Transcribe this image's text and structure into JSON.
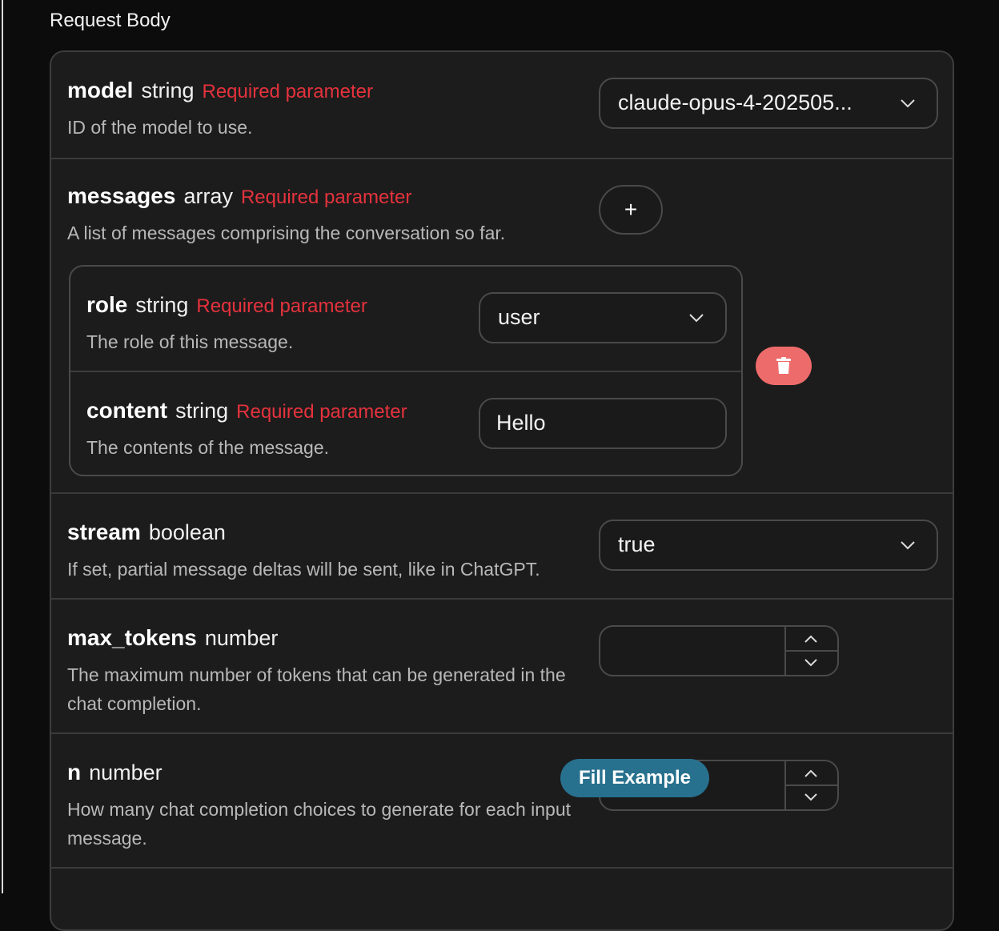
{
  "section_title": "Request Body",
  "required_label": "Required parameter",
  "params": {
    "model": {
      "name": "model",
      "type": "string",
      "required": true,
      "description": "ID of the model to use.",
      "value": "claude-opus-4-202505..."
    },
    "messages": {
      "name": "messages",
      "type": "array",
      "required": true,
      "description": "A list of messages comprising the conversation so far.",
      "add_label": "+"
    },
    "role": {
      "name": "role",
      "type": "string",
      "required": true,
      "description": "The role of this message.",
      "value": "user"
    },
    "content": {
      "name": "content",
      "type": "string",
      "required": true,
      "description": "The contents of the message.",
      "value": "Hello"
    },
    "stream": {
      "name": "stream",
      "type": "boolean",
      "description": "If set, partial message deltas will be sent, like in ChatGPT.",
      "value": "true"
    },
    "max_tokens": {
      "name": "max_tokens",
      "type": "number",
      "description": "The maximum number of tokens that can be generated in the chat completion.",
      "value": ""
    },
    "n": {
      "name": "n",
      "type": "number",
      "description": "How many chat completion choices to generate for each input message.",
      "value": ""
    }
  },
  "fill_example_label": "Fill Example",
  "colors": {
    "required": "#e5323d",
    "delete_button": "#ee6b6b",
    "fill_button": "#27718e"
  },
  "icons": {
    "select": "chevron-down-icon",
    "delete": "trash-icon",
    "stepper_up": "chevron-up-icon",
    "stepper_down": "chevron-down-icon"
  }
}
